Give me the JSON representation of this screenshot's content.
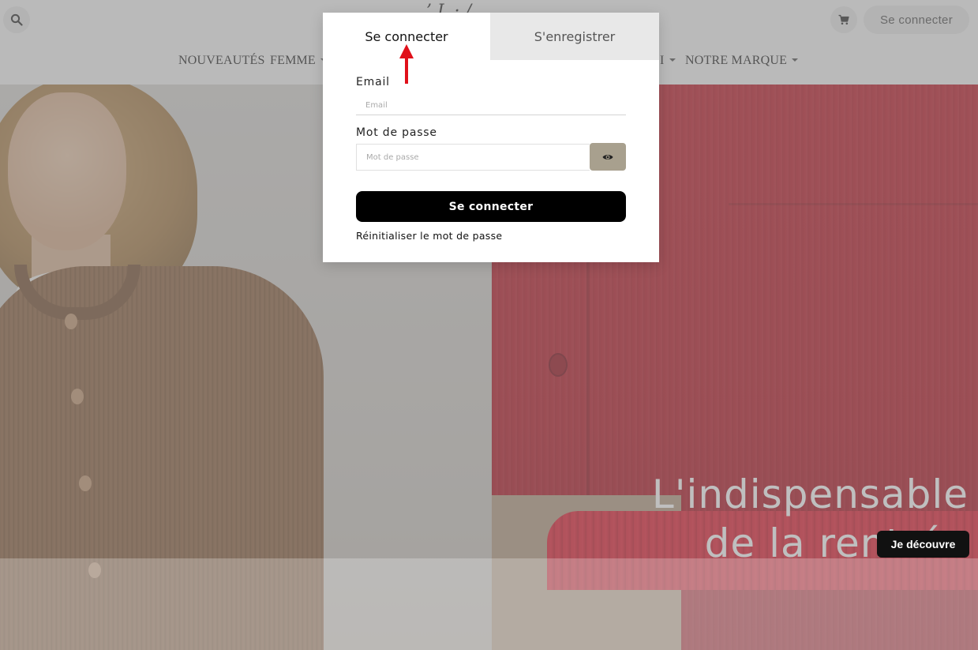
{
  "header": {
    "logo_text": "’ L · /",
    "login_label": "Se connecter",
    "nav": [
      {
        "label": "NOUVEAUTÉS",
        "has_caret": false
      },
      {
        "label": "FEMME",
        "has_caret": true
      },
      {
        "label": "I",
        "has_caret": true
      },
      {
        "label": "NOTRE MARQUE",
        "has_caret": true
      }
    ]
  },
  "hero": {
    "headline_line1": "L'indispensable",
    "headline_line2": "de la rentrée",
    "cta_label": "Je découvre"
  },
  "modal": {
    "tabs": [
      {
        "label": "Se connecter",
        "active": true
      },
      {
        "label": "S'enregistrer",
        "active": false
      }
    ],
    "email": {
      "label": "Email",
      "placeholder": "Email",
      "value": ""
    },
    "password": {
      "label": "Mot de passe",
      "placeholder": "Mot de passe",
      "value": ""
    },
    "submit_label": "Se connecter",
    "reset_label": "Réinitialiser le mot de passe"
  },
  "annotation": {
    "color": "#e0101a",
    "icon": "arrow-up-icon"
  },
  "colors": {
    "eye_button": "#a8a08e",
    "submit_button": "#000000",
    "inactive_tab": "#e8e8e8",
    "hero_right": "#c0202e"
  }
}
